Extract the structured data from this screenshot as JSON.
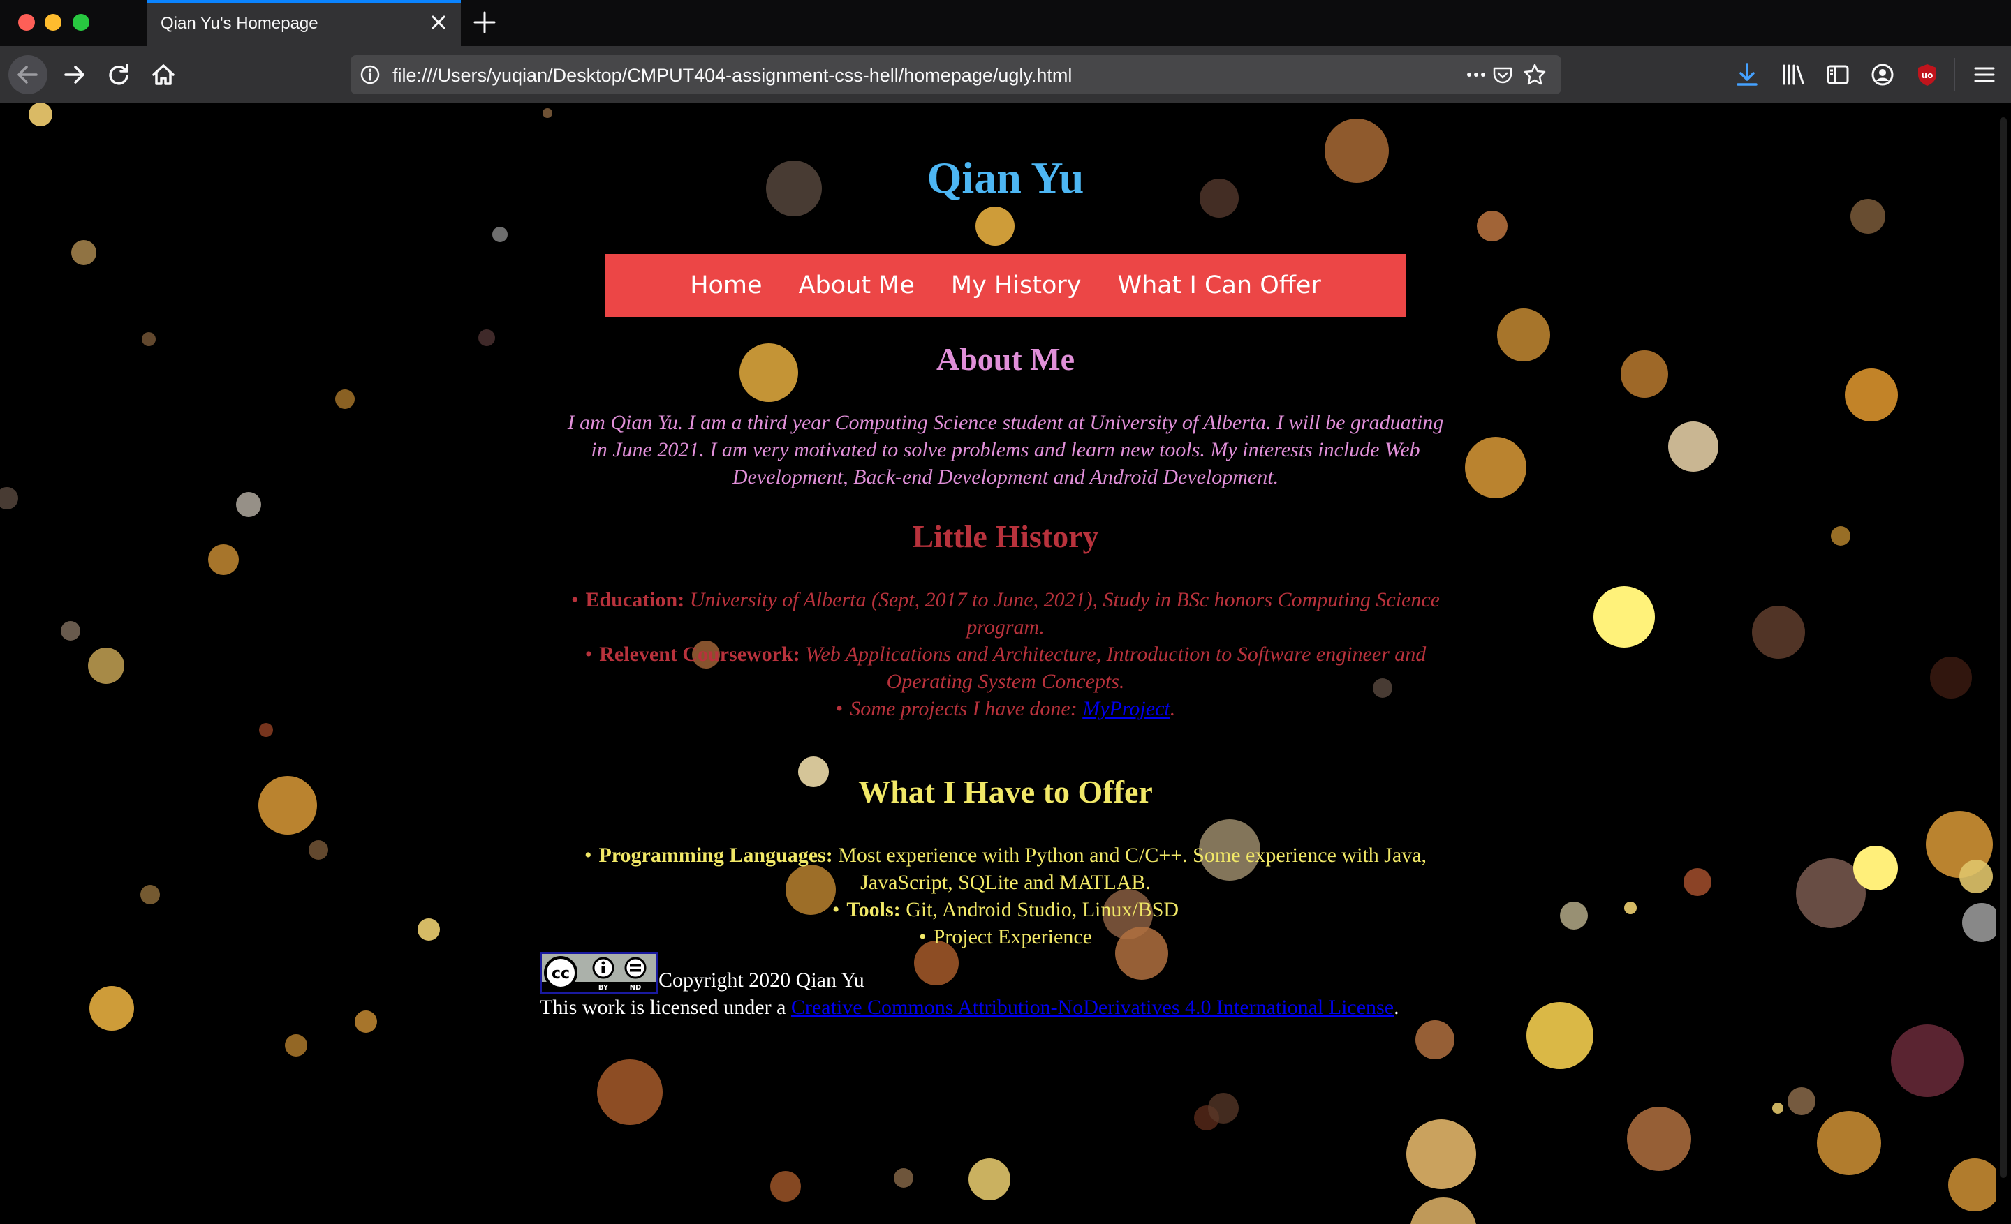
{
  "browser": {
    "tab_title": "Qian Yu's Homepage",
    "url": "file:///Users/yuqian/Desktop/CMPUT404-assignment-css-hell/homepage/ugly.html",
    "icons": [
      "back-arrow-icon",
      "forward-arrow-icon",
      "reload-icon",
      "home-icon",
      "info-icon",
      "more-dots-icon",
      "pocket-icon",
      "bookmark-star-icon",
      "download-icon",
      "library-icon",
      "sidebar-icon",
      "account-icon",
      "ublock-icon",
      "hamburger-menu-icon"
    ]
  },
  "page": {
    "title": "Qian Yu",
    "nav": [
      "Home",
      "About Me",
      "My History",
      "What I Can Offer"
    ],
    "about": {
      "heading": "About Me",
      "text": "I am Qian Yu. I am a third year Computing Science student at University of Alberta. I will be graduating in June 2021. I am very motivated to solve problems and learn new tools. My interests include Web Development, Back-end Development and Android Development."
    },
    "history": {
      "heading": "Little History",
      "items": [
        {
          "label": "Education:",
          "text": "University of Alberta (Sept, 2017 to June, 2021), Study in BSc honors Computing Science program."
        },
        {
          "label": "Relevent Coursework:",
          "text": "Web Applications and Architecture, Introduction to Software engineer and Operating System Concepts."
        },
        {
          "label": "",
          "text": "Some projects I have done: ",
          "link": "MyProject",
          "after": "."
        }
      ]
    },
    "offer": {
      "heading": "What I Have to Offer",
      "items": [
        {
          "label": "Programming Languages:",
          "text": "Most experience with Python and C/C++. Some experience with Java, JavaScript, SQLite and MATLAB."
        },
        {
          "label": "Tools:",
          "text": "Git, Android Studio, Linux/BSD"
        },
        {
          "label": "",
          "text": "Project Experience"
        }
      ]
    },
    "footer": {
      "copyright": "Copyright 2020 Qian Yu",
      "license_prefix": "This work is licensed under a ",
      "license_link": "Creative Commons Attribution-NoDerivatives 4.0 International License",
      "license_suffix": ".",
      "badge_text": [
        "cc",
        "BY",
        "ND"
      ]
    }
  },
  "colors": {
    "title": "#4db6f3",
    "nav_bg": "#ec4646",
    "about": "#e08fd8",
    "history": "#b8323c",
    "offer": "#f1e867",
    "link": "#0000ee",
    "tab_accent": "#0a84ff"
  }
}
